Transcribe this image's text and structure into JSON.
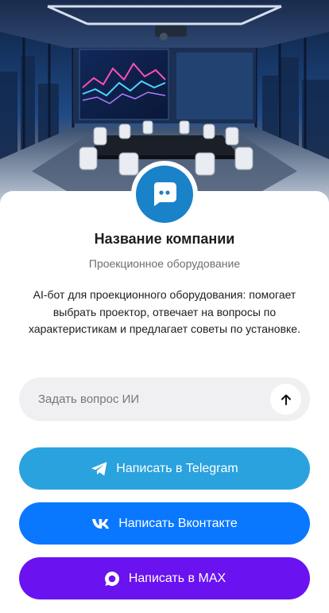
{
  "company": {
    "name": "Название компании",
    "subtitle": "Проекционное оборудование",
    "description": "AI-бот для проекционного оборудования: помогает выбрать проектор, отвечает на вопросы по характеристикам и предлагает советы по установке."
  },
  "ask": {
    "placeholder": "Задать вопрос ИИ",
    "send_icon": "arrow-up-icon"
  },
  "buttons": [
    {
      "label": "Написать в Telegram",
      "icon": "telegram-icon",
      "color": "#2aa2de"
    },
    {
      "label": "Написать Вконтакте",
      "icon": "vk-icon",
      "color": "#0a77ff"
    },
    {
      "label": "Написать в MAX",
      "icon": "max-icon",
      "color": "#6a12ef"
    }
  ],
  "colors": {
    "avatar": "#1a82c9",
    "ask_background": "#f0f0f2"
  }
}
